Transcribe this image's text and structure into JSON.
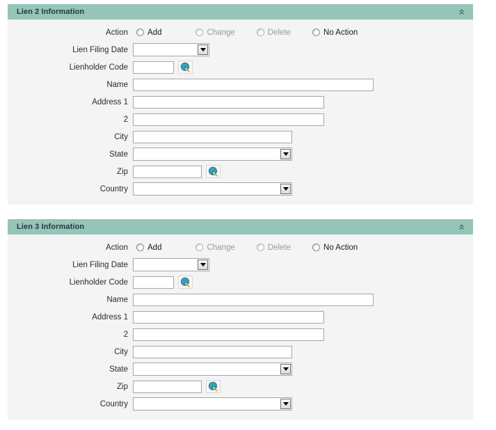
{
  "theme": {
    "header_bg": "#95c4b8",
    "panel_bg": "#f4f4f4",
    "header_text": "#1f3a3a",
    "label_text": "#2b2b2b",
    "disabled_text": "#999999",
    "input_border": "#a6a6a6"
  },
  "panels": [
    {
      "title": "Lien 2 Information",
      "collapse_icon": "double-chevron-up-icon",
      "fields": {
        "action_label": "Action",
        "action_options": [
          {
            "label": "Add",
            "selected": false,
            "disabled": false
          },
          {
            "label": "Change",
            "selected": false,
            "disabled": true
          },
          {
            "label": "Delete",
            "selected": false,
            "disabled": true
          },
          {
            "label": "No Action",
            "selected": false,
            "disabled": false
          }
        ],
        "lien_filing_date_label": "Lien Filing Date",
        "lien_filing_date_value": "",
        "lienholder_code_label": "Lienholder Code",
        "lienholder_code_value": "",
        "lienholder_lookup_icon": "globe-search-icon",
        "name_label": "Name",
        "name_value": "",
        "address1_label": "Address 1",
        "address1_value": "",
        "address2_label": "2",
        "address2_value": "",
        "city_label": "City",
        "city_value": "",
        "state_label": "State",
        "state_value": "",
        "zip_label": "Zip",
        "zip_value": "",
        "zip_lookup_icon": "globe-search-icon",
        "country_label": "Country",
        "country_value": ""
      }
    },
    {
      "title": "Lien 3 Information",
      "collapse_icon": "double-chevron-up-icon",
      "fields": {
        "action_label": "Action",
        "action_options": [
          {
            "label": "Add",
            "selected": false,
            "disabled": false
          },
          {
            "label": "Change",
            "selected": false,
            "disabled": true
          },
          {
            "label": "Delete",
            "selected": false,
            "disabled": true
          },
          {
            "label": "No Action",
            "selected": false,
            "disabled": false
          }
        ],
        "lien_filing_date_label": "Lien Filing Date",
        "lien_filing_date_value": "",
        "lienholder_code_label": "Lienholder Code",
        "lienholder_code_value": "",
        "lienholder_lookup_icon": "globe-search-icon",
        "name_label": "Name",
        "name_value": "",
        "address1_label": "Address 1",
        "address1_value": "",
        "address2_label": "2",
        "address2_value": "",
        "city_label": "City",
        "city_value": "",
        "state_label": "State",
        "state_value": "",
        "zip_label": "Zip",
        "zip_value": "",
        "zip_lookup_icon": "globe-search-icon",
        "country_label": "Country",
        "country_value": ""
      }
    }
  ]
}
